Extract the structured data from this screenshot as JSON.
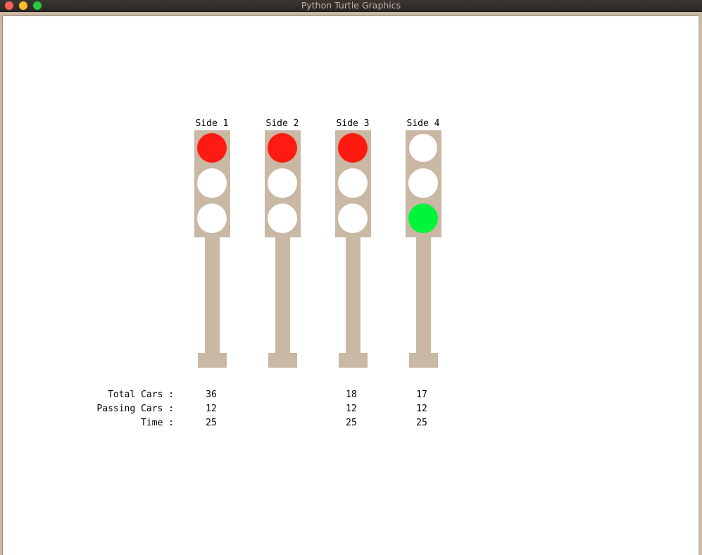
{
  "window": {
    "title": "Python Turtle Graphics"
  },
  "colors": {
    "red": "#ff1a12",
    "green": "#00f53a",
    "off": "#ffffff",
    "housing": "#c9b8a4"
  },
  "lights": [
    {
      "label": "Side 1",
      "states": [
        "red",
        "off",
        "off"
      ]
    },
    {
      "label": "Side 2",
      "states": [
        "red",
        "off",
        "off"
      ]
    },
    {
      "label": "Side 3",
      "states": [
        "red",
        "off",
        "off"
      ]
    },
    {
      "label": "Side 4",
      "states": [
        "off",
        "off",
        "green"
      ]
    }
  ],
  "stats": {
    "labels": [
      "Total Cars :",
      "Passing Cars :",
      "Time :"
    ],
    "columns": [
      {
        "total": "36",
        "passing": "12",
        "time": "25"
      },
      {
        "total": "",
        "passing": "",
        "time": ""
      },
      {
        "total": "18",
        "passing": "12",
        "time": "25"
      },
      {
        "total": "17",
        "passing": "12",
        "time": "25"
      }
    ]
  }
}
